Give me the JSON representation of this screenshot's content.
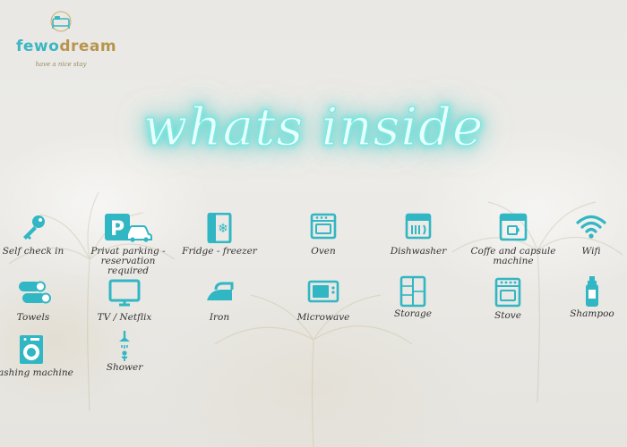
{
  "brand": {
    "name_part1": "fewo",
    "name_part2": "dream",
    "tagline": "have a nice stay",
    "colors": {
      "teal": "#3bb6c2",
      "gold": "#b7954e"
    }
  },
  "title": "whats inside",
  "colors": {
    "neon": "#4fd9d4",
    "icon": "#31b6c4",
    "text": "#333333"
  },
  "amenities": [
    {
      "label": "Self check in",
      "icon": "key-icon"
    },
    {
      "label": "Privat parking - reservation required",
      "icon": "parking-icon"
    },
    {
      "label": "Fridge - freezer",
      "icon": "fridge-icon"
    },
    {
      "label": "Oven",
      "icon": "oven-icon"
    },
    {
      "label": "Dishwasher",
      "icon": "dishwasher-icon"
    },
    {
      "label": "Coffe and capsule machine",
      "icon": "coffee-machine-icon"
    },
    {
      "label": "Wifi",
      "icon": "wifi-icon"
    },
    {
      "label": "Towels",
      "icon": "towels-icon"
    },
    {
      "label": "TV / Netflix",
      "icon": "tv-icon"
    },
    {
      "label": "Iron",
      "icon": "iron-icon"
    },
    {
      "label": "Microwave",
      "icon": "microwave-icon"
    },
    {
      "label": "Storage",
      "icon": "storage-icon"
    },
    {
      "label": "Stove",
      "icon": "stove-icon"
    },
    {
      "label": "Shampoo",
      "icon": "shampoo-icon"
    },
    {
      "label": "Washing machine",
      "icon": "washing-machine-icon"
    },
    {
      "label": "Shower",
      "icon": "shower-icon"
    }
  ]
}
